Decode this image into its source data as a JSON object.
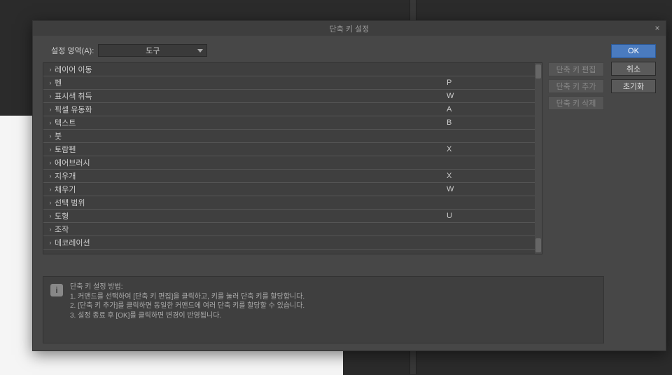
{
  "dialog": {
    "title": "단축 키 설정",
    "close_label": "×",
    "area_label": "설정 영역(A):",
    "area_value": "도구",
    "ok_label": "OK",
    "cancel_label": "취소",
    "reset_label": "초기화",
    "side_buttons": {
      "edit": "단축 키 편집",
      "add": "단축 키 추가",
      "delete": "단축 키 삭제"
    },
    "rows": [
      {
        "label": "레이어 이동",
        "key": ""
      },
      {
        "label": "펜",
        "key": "P"
      },
      {
        "label": "표시색 취득",
        "key": "W"
      },
      {
        "label": "픽셀 유동화",
        "key": "A"
      },
      {
        "label": "텍스트",
        "key": "B"
      },
      {
        "label": "붓",
        "key": ""
      },
      {
        "label": "토람펜",
        "key": "X"
      },
      {
        "label": "에어브러시",
        "key": ""
      },
      {
        "label": "지우개",
        "key": "X"
      },
      {
        "label": "채우기",
        "key": "W"
      },
      {
        "label": "선택 범위",
        "key": ""
      },
      {
        "label": "도형",
        "key": "U"
      },
      {
        "label": "조작",
        "key": ""
      },
      {
        "label": "데코레이션",
        "key": ""
      }
    ],
    "info": {
      "heading": "단축 키 설정 방법:",
      "line1": "1. 커맨드를 선택하여 [단축 키 편집]을 클릭하고, 키를 눌러 단축 키를 할당합니다.",
      "line2": "2. [단축 키 추가]를 클릭하면 동일한 커맨드에 여러 단축 키를 할당할 수 있습니다.",
      "line3": "3. 설정 종료 후 [OK]를 클릭하면 변경이 반영됩니다."
    }
  }
}
